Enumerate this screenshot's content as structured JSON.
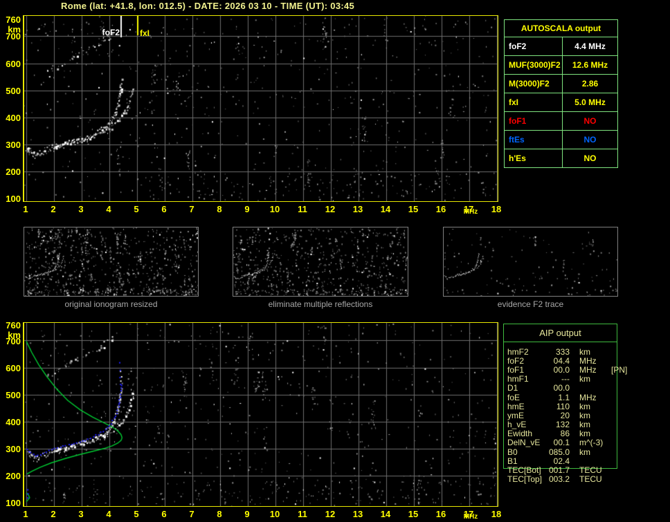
{
  "title": "Rome (lat: +41.8, lon: 012.5) - DATE: 2026 03 10 - TIME (UT): 03:45",
  "colors": {
    "accent_yellow": "#FFFF00",
    "title_yellow": "#F2F290",
    "plot_border": "#E8E800",
    "grid": "#6E6E6E",
    "trace_white": "#FFFFFF",
    "trace_gray": "#BBBBBB",
    "noise_gray": "#808080",
    "autoscala_border_green": "#7FE57F",
    "aip_border_green": "#3FBC3F",
    "aip_text": "#E6E69C",
    "caption_gray": "#A8A8A8",
    "status_red": "#FF0000",
    "status_blue": "#0066FF",
    "profile_green": "#00CC33",
    "restored_blue": "#2020FF"
  },
  "axes": {
    "y_ticks": [
      "760",
      "km",
      "700",
      "600",
      "500",
      "400",
      "300",
      "200",
      "100"
    ],
    "x_ticks": [
      "1",
      "2",
      "3",
      "4",
      "5",
      "6",
      "7",
      "8",
      "9",
      "10",
      "11",
      "12",
      "13",
      "14",
      "15",
      "16",
      "17",
      "18"
    ],
    "x_unit": "MHz"
  },
  "top_plot": {
    "foF2_label": "foF2",
    "fxI_label": "fxI"
  },
  "thumbnails": [
    {
      "caption": "original ionogram resized"
    },
    {
      "caption": "eliminate multiple reflections"
    },
    {
      "caption": "evidence F2 trace"
    }
  ],
  "autoscala_table": {
    "title": "AUTOSCALA output",
    "rows": [
      {
        "label": "foF2",
        "value": "4.4 MHz",
        "color": "#FFFFFF"
      },
      {
        "label": "MUF(3000)F2",
        "value": "12.6 MHz",
        "color": "#FFFF00"
      },
      {
        "label": "M(3000)F2",
        "value": "2.86",
        "color": "#FFFF00"
      },
      {
        "label": "fxI",
        "value": "5.0 MHz",
        "color": "#FFFF00"
      },
      {
        "label": "foF1",
        "value": "NO",
        "color": "#FF0000"
      },
      {
        "label": "ftEs",
        "value": "NO",
        "color": "#0066FF"
      },
      {
        "label": "h'Es",
        "value": "NO",
        "color": "#FFFF00"
      }
    ]
  },
  "aip_table": {
    "title": "AIP output",
    "rows": [
      {
        "label": "hmF2",
        "value": "333",
        "unit": "km",
        "extra": ""
      },
      {
        "label": "foF2",
        "value": "04.4",
        "unit": "MHz",
        "extra": ""
      },
      {
        "label": "foF1",
        "value": "00.0",
        "unit": "MHz",
        "extra": "[PN]"
      },
      {
        "label": "hmF1",
        "value": "---",
        "unit": "km",
        "extra": ""
      },
      {
        "label": "D1",
        "value": "00.0",
        "unit": "",
        "extra": ""
      },
      {
        "label": "foE",
        "value": "1.1",
        "unit": "MHz",
        "extra": ""
      },
      {
        "label": "hmE",
        "value": "110",
        "unit": "km",
        "extra": ""
      },
      {
        "label": "ymE",
        "value": "20",
        "unit": "km",
        "extra": ""
      },
      {
        "label": "h_vE",
        "value": "132",
        "unit": "km",
        "extra": ""
      },
      {
        "label": "Ewidth",
        "value": "86",
        "unit": "km",
        "extra": ""
      },
      {
        "label": "DelN_vE",
        "value": "00.1",
        "unit": "m^(-3)",
        "extra": ""
      },
      {
        "label": "B0",
        "value": "085.0",
        "unit": "km",
        "extra": ""
      },
      {
        "label": "B1",
        "value": "02.4",
        "unit": "",
        "extra": ""
      },
      {
        "label": "TEC[Bot]",
        "value": "001.7",
        "unit": "TECU",
        "extra": ""
      },
      {
        "label": "TEC[Top]",
        "value": "003.2",
        "unit": "TECU",
        "extra": ""
      }
    ]
  },
  "chart_data": {
    "type": "scatter",
    "title": "Ionogram with AUTOSCALA automatic scaling",
    "x_axis": {
      "label": "MHz",
      "range": [
        1,
        18
      ],
      "ticks": [
        1,
        2,
        3,
        4,
        5,
        6,
        7,
        8,
        9,
        10,
        11,
        12,
        13,
        14,
        15,
        16,
        17,
        18
      ]
    },
    "y_axis": {
      "label": "km",
      "range": [
        100,
        760
      ],
      "ticks": [
        100,
        200,
        300,
        400,
        500,
        600,
        700,
        760
      ]
    },
    "grid": true,
    "markers": {
      "foF2_mhz": 4.4,
      "fxI_mhz": 5.0
    },
    "scaled_values": {
      "foF2": 4.4,
      "MUF3000F2": 12.6,
      "M3000F2": 2.86,
      "fxI": 5.0,
      "hmF2": 333,
      "foE": 1.1,
      "hmE": 110,
      "B0": 85.0,
      "B1": 2.4,
      "TEC_bot": 1.7,
      "TEC_top": 3.2
    },
    "o_trace_mhz_km": [
      [
        1.0,
        292
      ],
      [
        1.15,
        278
      ],
      [
        1.3,
        267
      ],
      [
        1.5,
        272
      ],
      [
        1.8,
        288
      ],
      [
        2.2,
        300
      ],
      [
        2.6,
        310
      ],
      [
        3.0,
        322
      ],
      [
        3.3,
        334
      ],
      [
        3.6,
        348
      ],
      [
        3.85,
        365
      ],
      [
        4.05,
        388
      ],
      [
        4.2,
        415
      ],
      [
        4.3,
        448
      ],
      [
        4.36,
        485
      ],
      [
        4.4,
        520
      ],
      [
        4.41,
        540
      ]
    ],
    "x_trace_mhz_km": [
      [
        2.0,
        297
      ],
      [
        2.4,
        305
      ],
      [
        2.9,
        316
      ],
      [
        3.4,
        330
      ],
      [
        3.8,
        348
      ],
      [
        4.1,
        368
      ],
      [
        4.35,
        392
      ],
      [
        4.55,
        420
      ],
      [
        4.7,
        452
      ],
      [
        4.8,
        487
      ],
      [
        4.87,
        515
      ]
    ],
    "multiple_reflection_trace_mhz_km": [
      [
        1.7,
        570
      ],
      [
        2.1,
        590
      ],
      [
        2.5,
        612
      ],
      [
        2.9,
        634
      ],
      [
        3.3,
        655
      ],
      [
        3.7,
        678
      ],
      [
        4.0,
        700
      ],
      [
        4.2,
        718
      ]
    ],
    "asymptote_extra_mhz_km": [
      [
        4.39,
        552
      ],
      [
        4.42,
        568
      ],
      [
        4.38,
        588
      ]
    ],
    "profile_topside_mhz_km": [
      [
        1.0,
        697
      ],
      [
        1.2,
        655
      ],
      [
        1.45,
        610
      ],
      [
        1.75,
        565
      ],
      [
        2.1,
        520
      ],
      [
        2.5,
        478
      ],
      [
        2.95,
        443
      ],
      [
        3.4,
        416
      ],
      [
        3.8,
        396
      ],
      [
        4.1,
        380
      ],
      [
        4.3,
        366
      ],
      [
        4.42,
        352
      ],
      [
        4.46,
        340
      ]
    ],
    "profile_bottomside_mhz_km": [
      [
        4.46,
        340
      ],
      [
        4.42,
        330
      ],
      [
        4.3,
        320
      ],
      [
        4.1,
        310
      ],
      [
        3.8,
        300
      ],
      [
        3.4,
        290
      ],
      [
        2.9,
        277
      ],
      [
        2.4,
        263
      ],
      [
        1.9,
        247
      ],
      [
        1.5,
        231
      ],
      [
        1.2,
        216
      ],
      [
        1.02,
        206
      ]
    ],
    "profile_e_layer_mhz_km": [
      [
        1.0,
        136
      ],
      [
        1.08,
        128
      ],
      [
        1.12,
        118
      ],
      [
        1.04,
        108
      ],
      [
        1.0,
        103
      ]
    ],
    "restored_trace_blue_extra_mhz_km": [
      [
        4.38,
        540
      ],
      [
        4.36,
        565
      ],
      [
        4.37,
        592
      ],
      [
        4.35,
        620
      ],
      [
        1.03,
        150
      ],
      [
        1.04,
        135
      ],
      [
        1.03,
        120
      ]
    ]
  }
}
